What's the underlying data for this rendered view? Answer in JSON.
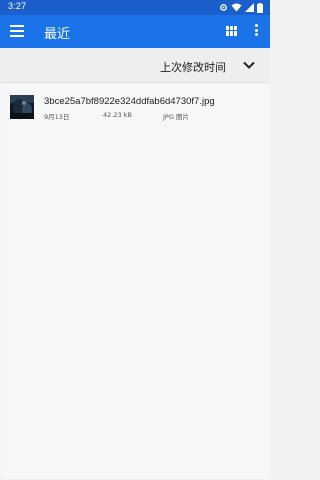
{
  "status_bar": {
    "time": "3:27"
  },
  "app_bar": {
    "title": "最近",
    "menu_icon": "menu-icon",
    "view_icon": "grid-view-icon",
    "more_icon": "more-vert-icon"
  },
  "sort_bar": {
    "label": "上次修改时间",
    "icon": "chevron-down-icon"
  },
  "files": [
    {
      "name": "3bce25a7bf8922e324ddfab6d4730f7.jpg",
      "date": "9月13日",
      "size": "42.23 kB",
      "type": "JPG 图片"
    }
  ],
  "colors": {
    "status_bar": "#1a5fcc",
    "app_bar": "#1a73e8",
    "sort_bar": "#eeeeee",
    "background": "#f7f7f7"
  }
}
